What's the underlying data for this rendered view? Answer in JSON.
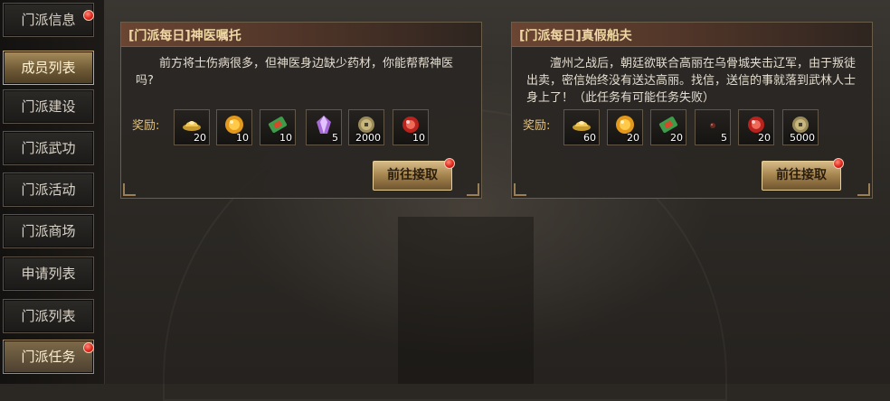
{
  "sidebar": {
    "items": [
      {
        "label": "门派信息"
      },
      {
        "label": "成员列表"
      },
      {
        "label": "门派建设"
      },
      {
        "label": "门派武功"
      },
      {
        "label": "门派活动"
      },
      {
        "label": "门派商场"
      },
      {
        "label": "申请列表"
      },
      {
        "label": "门派列表"
      },
      {
        "label": "门派任务"
      }
    ]
  },
  "tasks": [
    {
      "title": "[门派每日]神医嘱托",
      "description": "前方将士伤病很多，但神医身边缺少药材，你能帮帮神医吗?",
      "reward_label": "奖励:",
      "button_label": "前往接取",
      "rewards": [
        {
          "icon": "gold-ingot-icon",
          "qty": "20"
        },
        {
          "icon": "gold-orb-icon",
          "qty": "10"
        },
        {
          "icon": "scroll-ticket-icon",
          "qty": "10"
        },
        {
          "icon": "purple-crystal-icon",
          "qty": "5"
        },
        {
          "icon": "coin-icon",
          "qty": "2000"
        },
        {
          "icon": "red-gem-icon",
          "qty": "10"
        }
      ]
    },
    {
      "title": "[门派每日]真假船夫",
      "description": "澶州之战后，朝廷欲联合高丽在乌骨城夹击辽军，由于叛徒出卖，密信始终没有送达高丽。找信，送信的事就落到武林人士身上了！（此任务有可能任务失败）",
      "reward_label": "奖励:",
      "button_label": "前往接取",
      "rewards": [
        {
          "icon": "gold-ingot-icon",
          "qty": "60"
        },
        {
          "icon": "gold-orb-icon",
          "qty": "20"
        },
        {
          "icon": "scroll-ticket-icon",
          "qty": "20"
        },
        {
          "icon": "dark-bead-icon",
          "qty": "5"
        },
        {
          "icon": "red-gem-icon",
          "qty": "20"
        },
        {
          "icon": "coin-icon",
          "qty": "5000"
        }
      ]
    }
  ]
}
